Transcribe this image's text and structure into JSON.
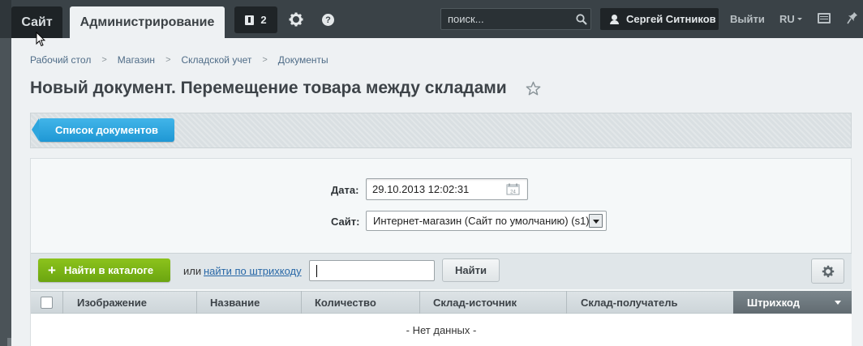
{
  "topbar": {
    "site_tab": "Сайт",
    "admin_tab": "Администрирование",
    "notifications_count": "2",
    "search_placeholder": "поиск...",
    "user_name": "Сергей Ситников",
    "logout": "Выйти",
    "language": "RU"
  },
  "breadcrumb": [
    "Рабочий стол",
    "Магазин",
    "Складской учет",
    "Документы"
  ],
  "page": {
    "title": "Новый документ. Перемещение товара между складами"
  },
  "toolbar": {
    "list_button": "Список документов"
  },
  "form": {
    "date_label": "Дата:",
    "date_value": "29.10.2013 12:02:31",
    "site_label": "Сайт:",
    "site_value": "Интернет-магазин (Сайт по умолчанию) (s1)"
  },
  "search_bar": {
    "find_catalog": "Найти в каталоге",
    "or": "или",
    "barcode_link": "найти по штрихкоду",
    "find_button": "Найти"
  },
  "table": {
    "columns": [
      "Изображение",
      "Название",
      "Количество",
      "Склад-источник",
      "Склад-получатель",
      "Штрихкод"
    ],
    "empty_text": "- Нет данных -"
  },
  "colors": {
    "topbar": "#3a4247",
    "accent_blue": "#2ea6de",
    "accent_green": "#7ab417",
    "link": "#2767a6"
  },
  "icons": [
    "notification-icon",
    "gear-icon",
    "help-icon",
    "search-icon",
    "user-icon",
    "keyboard-icon",
    "pin-icon",
    "star-icon",
    "calendar-icon",
    "select-arrow-icon",
    "plus-icon",
    "settings-icon",
    "sort-arrow-icon",
    "cursor-icon"
  ]
}
